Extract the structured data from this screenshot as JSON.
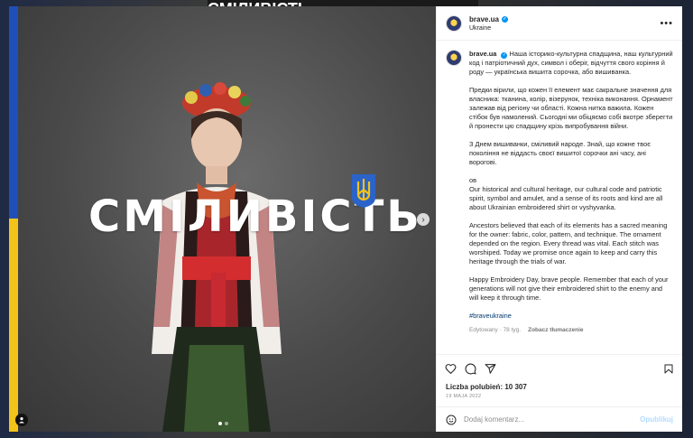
{
  "background": {
    "partial_text": "СМІЛИВІСТЬ"
  },
  "media": {
    "headline": "СМІЛИВІСТЬ",
    "flag_colors": [
      "#1f4fb8",
      "#f2c318"
    ],
    "slide_count": 2,
    "active_slide": 0
  },
  "post": {
    "username": "brave.ua",
    "location": "Ukraine",
    "caption": {
      "uk_1": "Наша історико-культурна спадщина, наш культурний код і патріотичний дух, символ і оберіг, відчуття свого коріння й роду — українська вишита сорочка, або вишиванка.",
      "uk_2": "Предки вірили, що кожен її елемент має сакральне значення для власника: тканина, колір, візерунок, техніка виконання. Орнамент залежав від регіону чи області. Кожна нитка важила. Кожен стібок був намолений. Сьогодні ми обіцяємо собі вкотре зберегти й пронести цю спадщину крізь випробування війни.",
      "uk_3": "З Днем вишиванки, сміливий народе. Знай, що кожне твоє покоління не віддасть своєї вишитої сорочки ані часу, ані ворогові.",
      "divider": "ов",
      "en_1": "Our historical and cultural heritage, our cultural code and patriotic spirit, symbol and amulet, and a sense of its roots and kind are all about Ukrainian embroidered shirt or vyshyvanka.",
      "en_2": "Ancestors believed that each of its elements has a sacred meaning for the owner: fabric, color, pattern, and technique. The ornament depended on the region. Every thread was vital. Each stitch was worshiped. Today we promise once again to keep and carry this heritage through the trials of war.",
      "en_3": "Happy Embroidery Day, brave people. Remember that each of your generations will not give their embroidered shirt to the enemy and will keep it through time.",
      "hashtag": "#braveukraine"
    },
    "meta": {
      "edited": "Edytowany · 78 tyg.",
      "translate": "Zobacz tłumaczenie"
    },
    "likes": "Liczba polubień: 10 307",
    "date": "19 MAJA 2022",
    "composer": {
      "placeholder": "Dodaj komentarz...",
      "post_label": "Opublikuj"
    }
  },
  "icons": [
    "verified-badge",
    "more-options",
    "heart",
    "comment",
    "share",
    "bookmark",
    "emoji",
    "user-tag",
    "chevron-right"
  ],
  "accent_color": "#0095f6"
}
